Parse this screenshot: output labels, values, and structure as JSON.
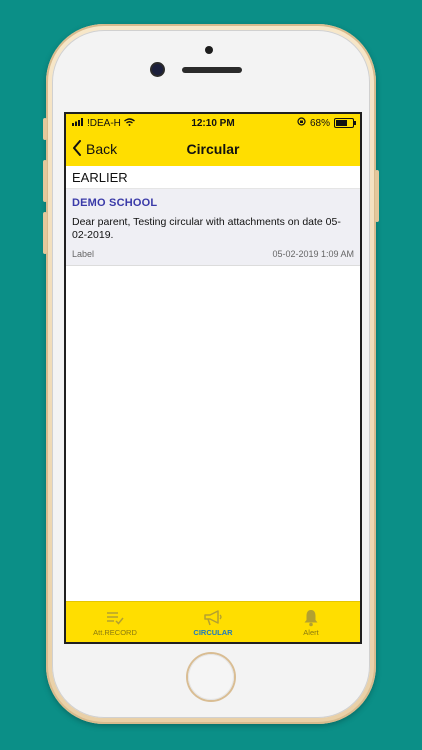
{
  "status_bar": {
    "carrier": "!DEA-H",
    "time": "12:10 PM",
    "battery_pct": "68%",
    "battery_level": 0.68
  },
  "nav": {
    "back_label": "Back",
    "title": "Circular"
  },
  "section": {
    "title": "EARLIER"
  },
  "circulars": [
    {
      "school": "DEMO SCHOOL",
      "message": "Dear parent, Testing circular with attachments on date 05-02-2019.",
      "label": "Label",
      "timestamp": "05-02-2019 1:09 AM"
    }
  ],
  "tabs": [
    {
      "label": "Att.RECORD",
      "icon": "attendance-record-icon",
      "active": false
    },
    {
      "label": "CIRCULAR",
      "icon": "megaphone-icon",
      "active": true
    },
    {
      "label": "Alert",
      "icon": "bell-icon",
      "active": false
    }
  ],
  "colors": {
    "accent": "#ffde00",
    "active_tab": "#1e7bbf",
    "school_name": "#3a3aa8",
    "background": "#0b8f87"
  }
}
